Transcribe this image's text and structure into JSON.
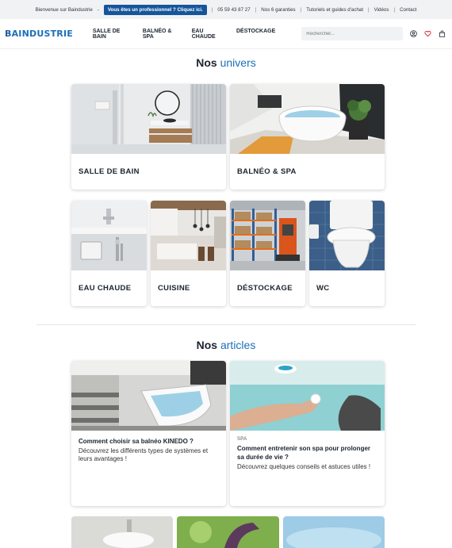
{
  "topbar": {
    "welcome": "Bienvenue sur Baindustrie",
    "dash": "-",
    "pro_label": "Vous êtes un professionnel ? Cliquez ici.",
    "phone": "05 59 43 87 27",
    "guarantees": "Nos 6 garanties",
    "tutorials": "Tutoriels et guides d'achat",
    "videos": "Vidéos",
    "contact": "Contact"
  },
  "header": {
    "logo_b": "B",
    "logo_rest": "AINDUSTRIE",
    "nav": [
      "SALLE DE BAIN",
      "BALNÉO & SPA",
      "EAU CHAUDE",
      "DÉSTOCKAGE"
    ],
    "search_placeholder": "Rechercher...",
    "icons": [
      "user-icon",
      "heart-icon",
      "bag-icon"
    ],
    "accent_color": "#1d6fb8"
  },
  "univers": {
    "title_plain": "Nos",
    "title_accent": "univers",
    "big": [
      "SALLE DE BAIN",
      "BALNÉO & SPA"
    ],
    "small": [
      "EAU CHAUDE",
      "CUISINE",
      "DÉSTOCKAGE",
      "WC"
    ]
  },
  "articles": {
    "title_plain": "Nos",
    "title_accent": "articles",
    "items": [
      {
        "category": "",
        "title": "Comment choisir sa balnéo KINEDO ?",
        "description": "Découvrez les différents types de systèmes et leurs avantages !"
      },
      {
        "category": "SPA",
        "title": "Comment entretenir son spa pour prolonger sa durée de vie ?",
        "description": "Découvrez quelques conseils et astuces utiles !"
      }
    ]
  }
}
